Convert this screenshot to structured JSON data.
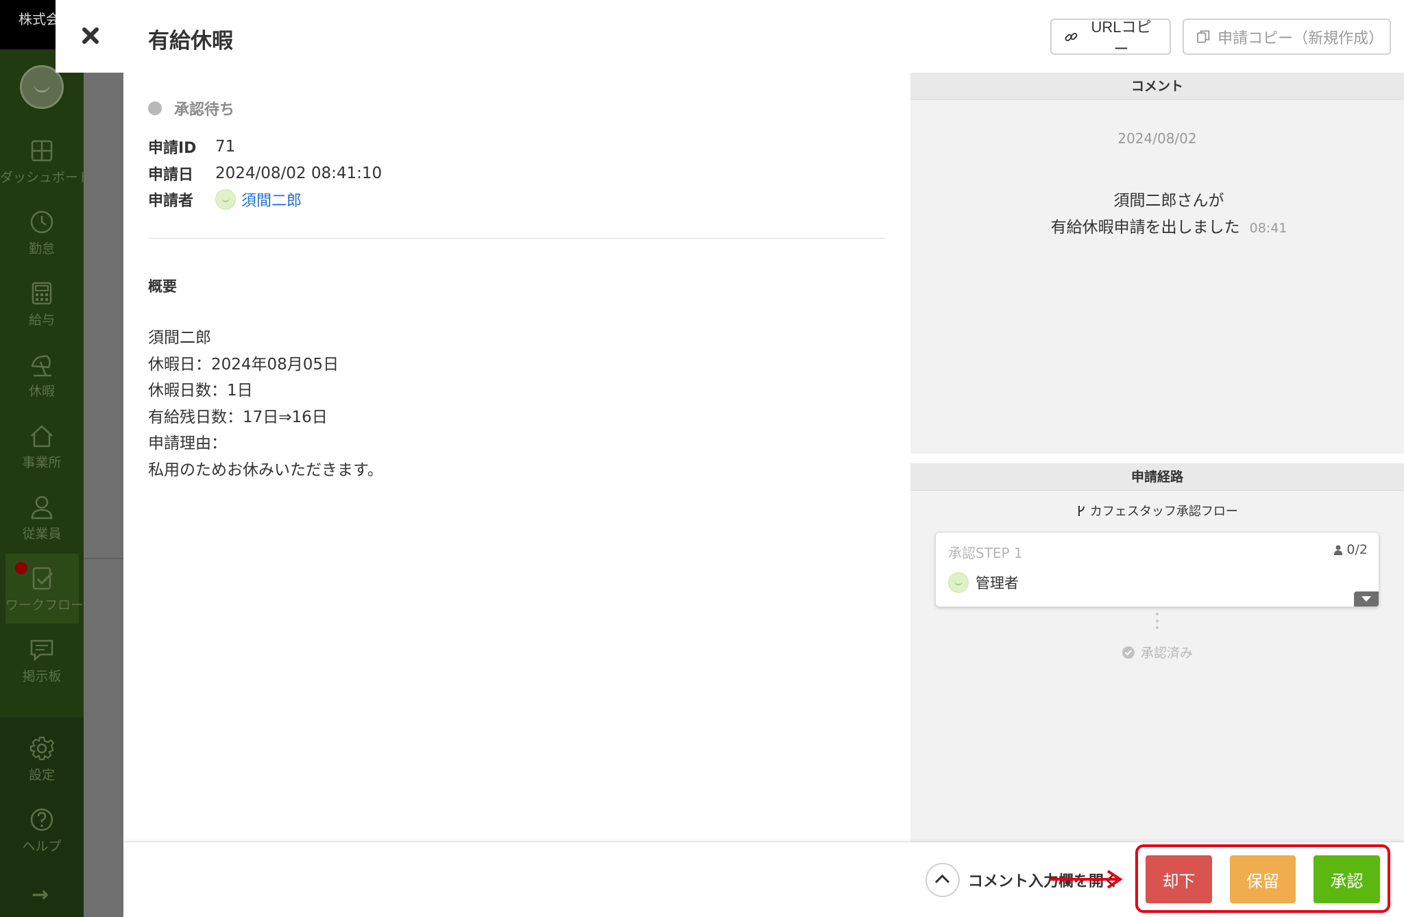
{
  "app": {
    "company": "株式会"
  },
  "sidebar": {
    "items": [
      {
        "label": "ダッシュボード",
        "icon": "dashboard-icon"
      },
      {
        "label": "勤怠",
        "icon": "clock-icon"
      },
      {
        "label": "給与",
        "icon": "calculator-icon"
      },
      {
        "label": "休暇",
        "icon": "beach-umbrella-icon"
      },
      {
        "label": "事業所",
        "icon": "home-icon"
      },
      {
        "label": "従業員",
        "icon": "user-icon"
      },
      {
        "label": "ワークフロー",
        "icon": "workflow-icon"
      },
      {
        "label": "掲示板",
        "icon": "message-board-icon"
      },
      {
        "label": "設定",
        "icon": "gear-icon"
      },
      {
        "label": "ヘルプ",
        "icon": "help-icon"
      }
    ]
  },
  "modal": {
    "title": "有給休暇",
    "url_copy_label": "URLコピー",
    "request_copy_label": "申請コピー（新規作成）",
    "status": "承認待ち",
    "fields": {
      "id_label": "申請ID",
      "id_value": "71",
      "date_label": "申請日",
      "date_value": "2024/08/02 08:41:10",
      "applicant_label": "申請者",
      "applicant_value": "須間二郎"
    },
    "summary": {
      "heading": "概要",
      "lines": [
        "須間二郎",
        "休暇日：2024年08月05日",
        "休暇日数：1日",
        "有給残日数：17日⇒16日",
        "申請理由：",
        "私用のためお休みいただきます。"
      ]
    }
  },
  "comments": {
    "header": "コメント",
    "date": "2024/08/02",
    "message_line1": "須間二郎さんが",
    "message_line2": "有給休暇申請を出しました",
    "time": "08:41"
  },
  "route": {
    "header": "申請経路",
    "flow_name": "カフェスタッフ承認フロー",
    "step_title": "承認STEP 1",
    "step_count": "0/2",
    "approver": "管理者",
    "approved_label": "承認済み"
  },
  "footer": {
    "comment_toggle_label": "コメント入力欄を開く",
    "reject_label": "却下",
    "hold_label": "保留",
    "approve_label": "承認"
  },
  "colors": {
    "reject": "#d9534f",
    "hold": "#f0ad4e",
    "approve": "#5cb811",
    "annotation": "#e60012",
    "link": "#1f6fd0"
  }
}
